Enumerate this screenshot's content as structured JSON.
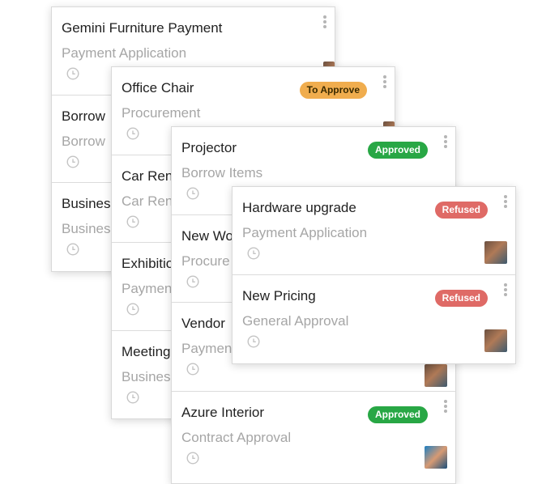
{
  "columns": [
    {
      "cards": [
        {
          "title": "Gemini Furniture Payment",
          "subtitle": "Payment Application"
        },
        {
          "title": "Borrow",
          "subtitle": "Borrow"
        },
        {
          "title": "Busines",
          "subtitle": "Busines"
        }
      ]
    },
    {
      "cards": [
        {
          "title": "Office Chair",
          "subtitle": "Procurement",
          "badge": "To Approve"
        },
        {
          "title": "Car Ren",
          "subtitle": "Car Ren"
        },
        {
          "title": "Exhibitio",
          "subtitle": "Paymen"
        },
        {
          "title": "Meeting",
          "subtitle": "Busines"
        }
      ]
    },
    {
      "cards": [
        {
          "title": "Projector",
          "subtitle": "Borrow Items",
          "badge": "Approved"
        },
        {
          "title": "New Wo",
          "subtitle": "Procure"
        },
        {
          "title": "Vendor",
          "subtitle": "Paymen"
        },
        {
          "title": "Azure Interior",
          "subtitle": "Contract Approval",
          "badge": "Approved"
        }
      ]
    },
    {
      "cards": [
        {
          "title": "Hardware upgrade",
          "subtitle": "Payment Application",
          "badge": "Refused"
        },
        {
          "title": "New Pricing",
          "subtitle": "General Approval",
          "badge": "Refused"
        }
      ]
    }
  ],
  "colors": {
    "approved": "#28a745",
    "refused": "#df6a66",
    "to_approve": "#f0ad4e"
  }
}
